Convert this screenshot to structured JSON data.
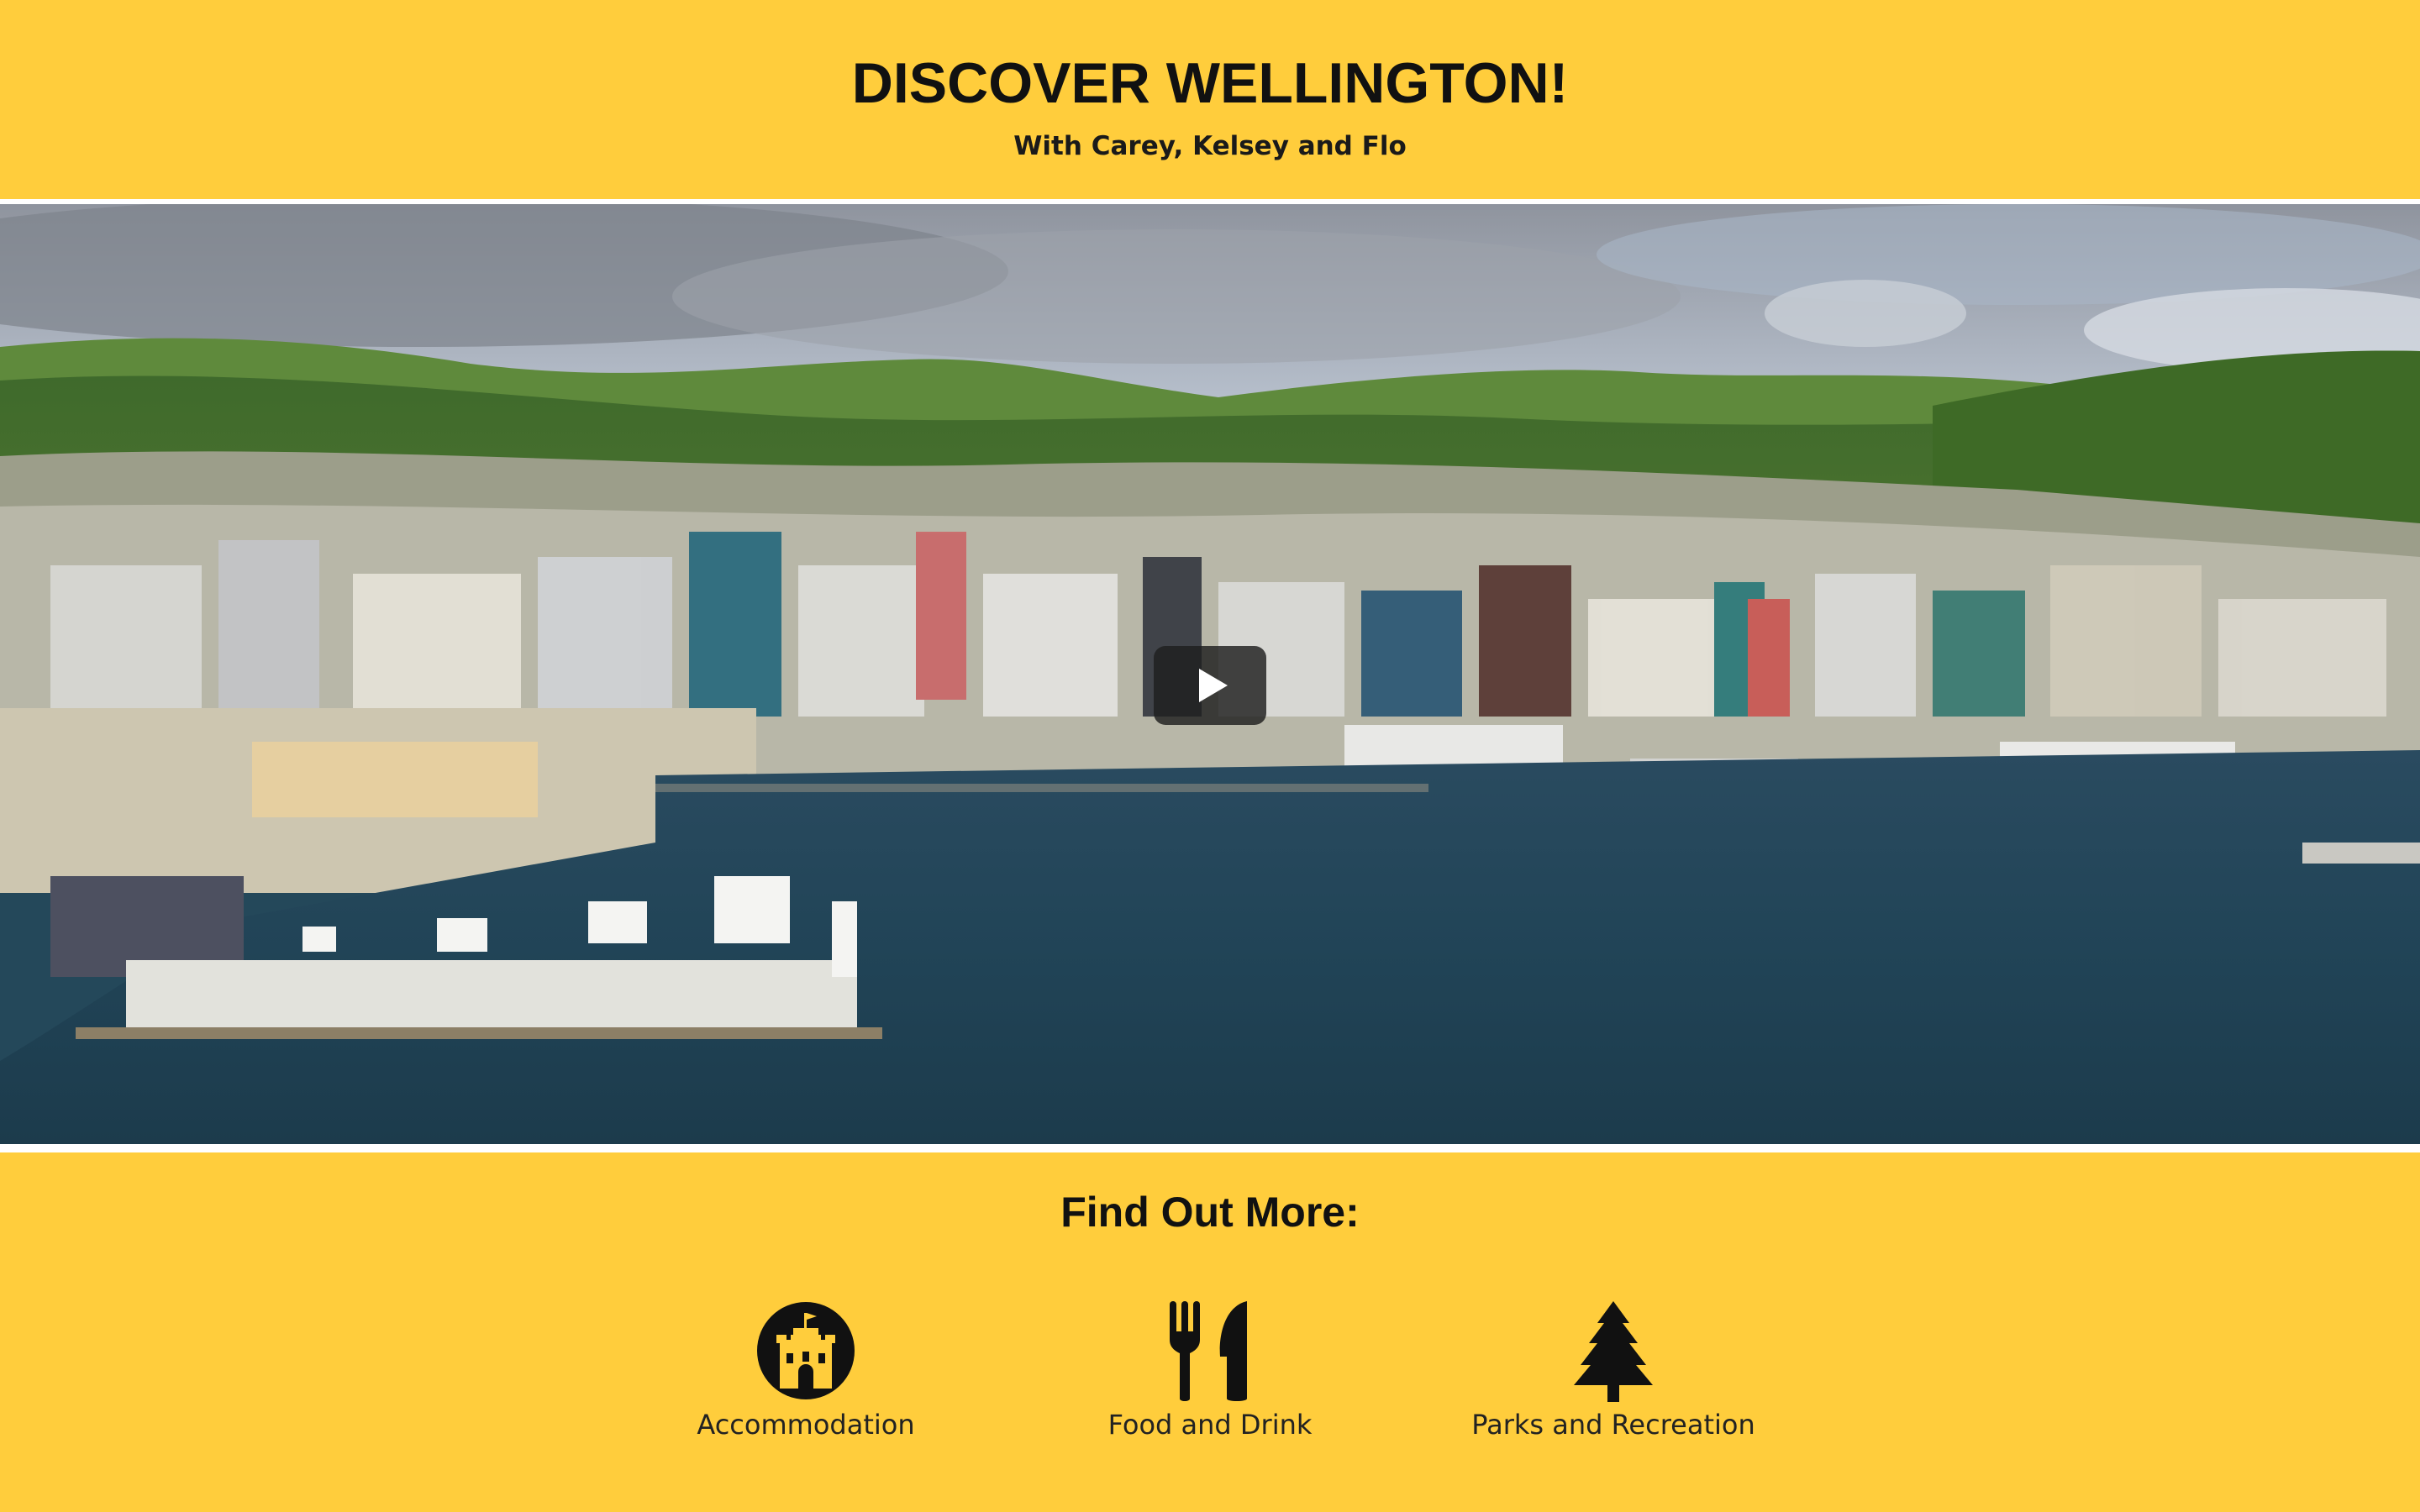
{
  "header": {
    "title": "DISCOVER WELLINGTON!",
    "subtitle": "With Carey, Kelsey and Flo"
  },
  "video": {
    "play_icon": "play-icon"
  },
  "find_out_more": {
    "title": "Find Out More:",
    "links": [
      {
        "label": "Accommodation",
        "icon": "castle-icon"
      },
      {
        "label": "Food and Drink",
        "icon": "fork-knife-icon"
      },
      {
        "label": "Parks and Recreation",
        "icon": "tree-icon"
      }
    ]
  },
  "colors": {
    "background": "#ffcd3c",
    "text": "#111111"
  }
}
